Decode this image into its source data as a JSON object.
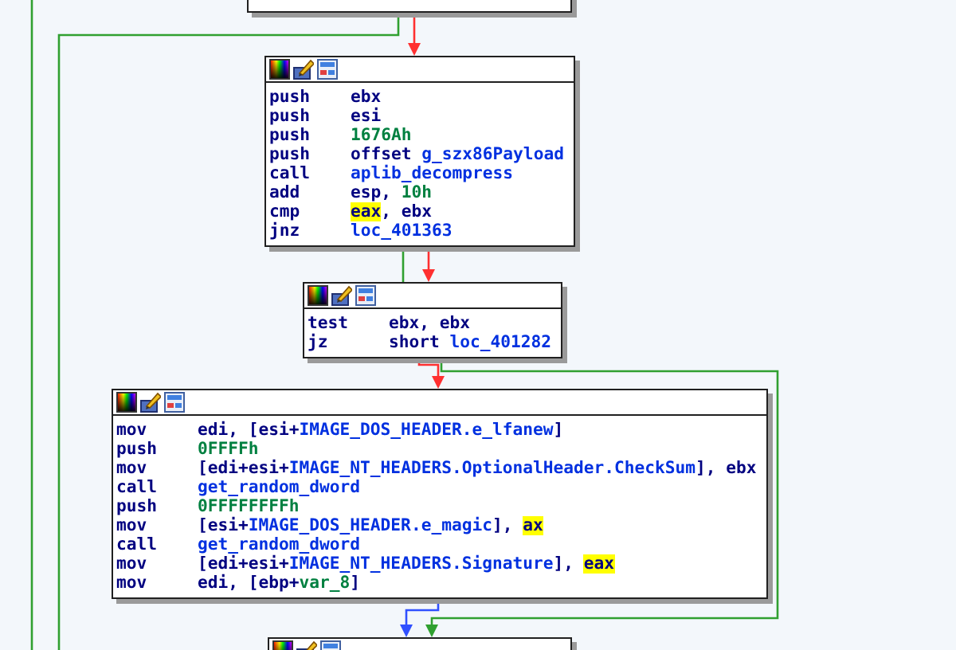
{
  "blocks": [
    {
      "kind": "cut_top"
    },
    {
      "kind": "full",
      "lines": [
        {
          "mnemonic": "push",
          "operands": [
            {
              "text": "ebx",
              "kind": "plain"
            }
          ]
        },
        {
          "mnemonic": "push",
          "operands": [
            {
              "text": "esi",
              "kind": "plain"
            }
          ]
        },
        {
          "mnemonic": "push",
          "operands": [
            {
              "text": "1676Ah",
              "kind": "num"
            }
          ]
        },
        {
          "mnemonic": "push",
          "operands": [
            {
              "text": "offset ",
              "kind": "plain"
            },
            {
              "text": "g_szx86Payload",
              "kind": "name"
            }
          ]
        },
        {
          "mnemonic": "call",
          "operands": [
            {
              "text": "aplib_decompress",
              "kind": "name"
            }
          ]
        },
        {
          "mnemonic": "add",
          "operands": [
            {
              "text": "esp, ",
              "kind": "plain"
            },
            {
              "text": "10h",
              "kind": "num"
            }
          ]
        },
        {
          "mnemonic": "cmp",
          "operands": [
            {
              "text": "eax",
              "kind": "highlight"
            },
            {
              "text": ", ebx",
              "kind": "plain"
            }
          ]
        },
        {
          "mnemonic": "jnz",
          "operands": [
            {
              "text": "loc_401363",
              "kind": "name"
            }
          ]
        }
      ]
    },
    {
      "kind": "full",
      "lines": [
        {
          "mnemonic": "test",
          "operands": [
            {
              "text": "ebx, ebx",
              "kind": "plain"
            }
          ]
        },
        {
          "mnemonic": "jz",
          "operands": [
            {
              "text": "short ",
              "kind": "plain"
            },
            {
              "text": "loc_401282",
              "kind": "name"
            }
          ]
        }
      ]
    },
    {
      "kind": "full",
      "lines": [
        {
          "mnemonic": "mov",
          "operands": [
            {
              "text": "edi, [esi+",
              "kind": "plain"
            },
            {
              "text": "IMAGE_DOS_HEADER.e_lfanew",
              "kind": "name"
            },
            {
              "text": "]",
              "kind": "plain"
            }
          ]
        },
        {
          "mnemonic": "push",
          "operands": [
            {
              "text": "0FFFFh",
              "kind": "num"
            }
          ]
        },
        {
          "mnemonic": "mov",
          "operands": [
            {
              "text": "[edi+esi+",
              "kind": "plain"
            },
            {
              "text": "IMAGE_NT_HEADERS.OptionalHeader.CheckSum",
              "kind": "name"
            },
            {
              "text": "], ebx",
              "kind": "plain"
            }
          ]
        },
        {
          "mnemonic": "call",
          "operands": [
            {
              "text": "get_random_dword",
              "kind": "name"
            }
          ]
        },
        {
          "mnemonic": "push",
          "operands": [
            {
              "text": "0FFFFFFFFh",
              "kind": "num"
            }
          ]
        },
        {
          "mnemonic": "mov",
          "operands": [
            {
              "text": "[esi+",
              "kind": "plain"
            },
            {
              "text": "IMAGE_DOS_HEADER.e_magic",
              "kind": "name"
            },
            {
              "text": "], ",
              "kind": "plain"
            },
            {
              "text": "ax",
              "kind": "highlight"
            }
          ]
        },
        {
          "mnemonic": "call",
          "operands": [
            {
              "text": "get_random_dword",
              "kind": "name"
            }
          ]
        },
        {
          "mnemonic": "mov",
          "operands": [
            {
              "text": "[edi+esi+",
              "kind": "plain"
            },
            {
              "text": "IMAGE_NT_HEADERS.Signature",
              "kind": "name"
            },
            {
              "text": "], ",
              "kind": "plain"
            },
            {
              "text": "eax",
              "kind": "highlight"
            }
          ]
        },
        {
          "mnemonic": "mov",
          "operands": [
            {
              "text": "edi, [ebp+",
              "kind": "plain"
            },
            {
              "text": "var_8",
              "kind": "num"
            },
            {
              "text": "]",
              "kind": "plain"
            }
          ]
        }
      ]
    },
    {
      "kind": "cut_bottom"
    }
  ],
  "edges": [
    {
      "kind": "true"
    },
    {
      "kind": "true"
    },
    {
      "kind": "false"
    },
    {
      "kind": "true"
    },
    {
      "kind": "false"
    },
    {
      "kind": "false"
    },
    {
      "kind": "true"
    },
    {
      "kind": "normal"
    }
  ]
}
